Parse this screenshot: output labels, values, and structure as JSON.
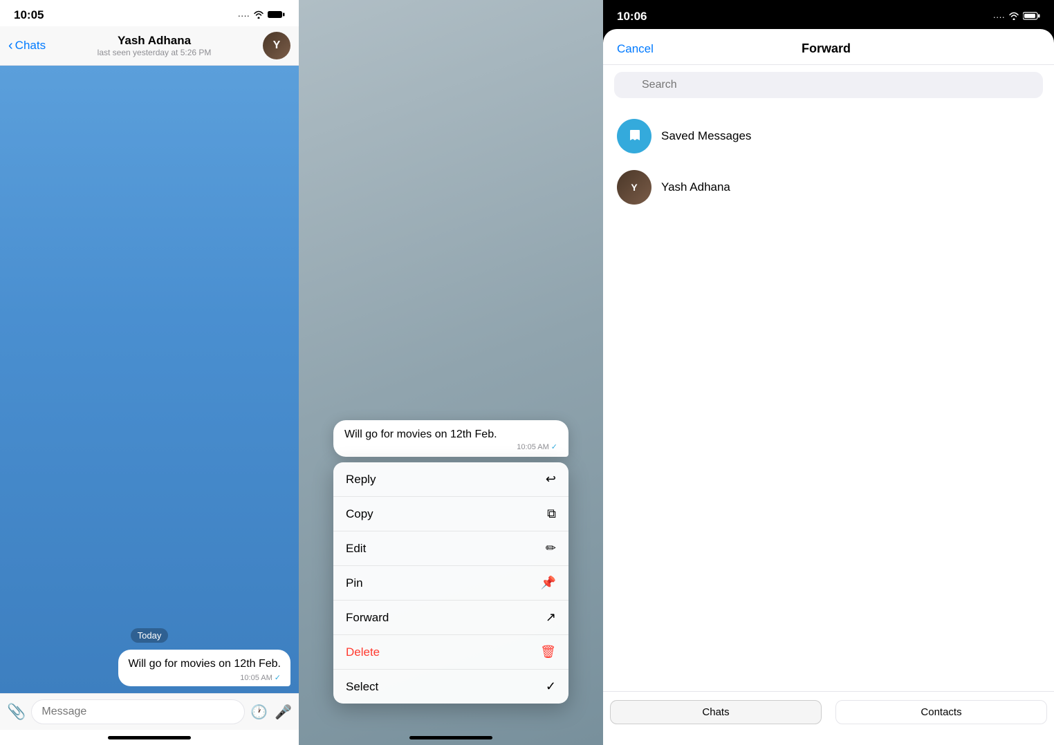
{
  "panel1": {
    "status_time": "10:05",
    "status_signal": "····",
    "status_wifi": "WiFi",
    "status_battery": "🔋",
    "back_label": "Chats",
    "contact_name": "Yash Adhana",
    "contact_status": "last seen yesterday at 5:26 PM",
    "date_label": "Today",
    "message_text": "Will go for movies on 12th Feb.",
    "message_time": "10:05 AM",
    "message_check": "✓",
    "input_placeholder": "Message",
    "attach_icon": "📎",
    "schedule_icon": "🕐",
    "mic_icon": "🎤"
  },
  "panel2": {
    "message_text": "Will go for movies on 12th Feb.",
    "message_time": "10:05 AM",
    "message_check": "✓",
    "menu_items": [
      {
        "label": "Reply",
        "icon": "↩",
        "type": "normal"
      },
      {
        "label": "Copy",
        "icon": "⧉",
        "type": "normal"
      },
      {
        "label": "Edit",
        "icon": "✏",
        "type": "normal"
      },
      {
        "label": "Pin",
        "icon": "📌",
        "type": "normal"
      },
      {
        "label": "Forward",
        "icon": "↗",
        "type": "normal"
      },
      {
        "label": "Delete",
        "icon": "🗑",
        "type": "delete"
      },
      {
        "label": "Select",
        "icon": "✓",
        "type": "normal"
      }
    ]
  },
  "panel3": {
    "status_time": "10:06",
    "cancel_label": "Cancel",
    "title": "Forward",
    "search_placeholder": "Search",
    "contacts": [
      {
        "name": "Saved Messages",
        "type": "saved"
      },
      {
        "name": "Yash Adhana",
        "type": "user"
      }
    ],
    "tabs": [
      {
        "label": "Chats",
        "active": true
      },
      {
        "label": "Contacts",
        "active": false
      }
    ]
  }
}
